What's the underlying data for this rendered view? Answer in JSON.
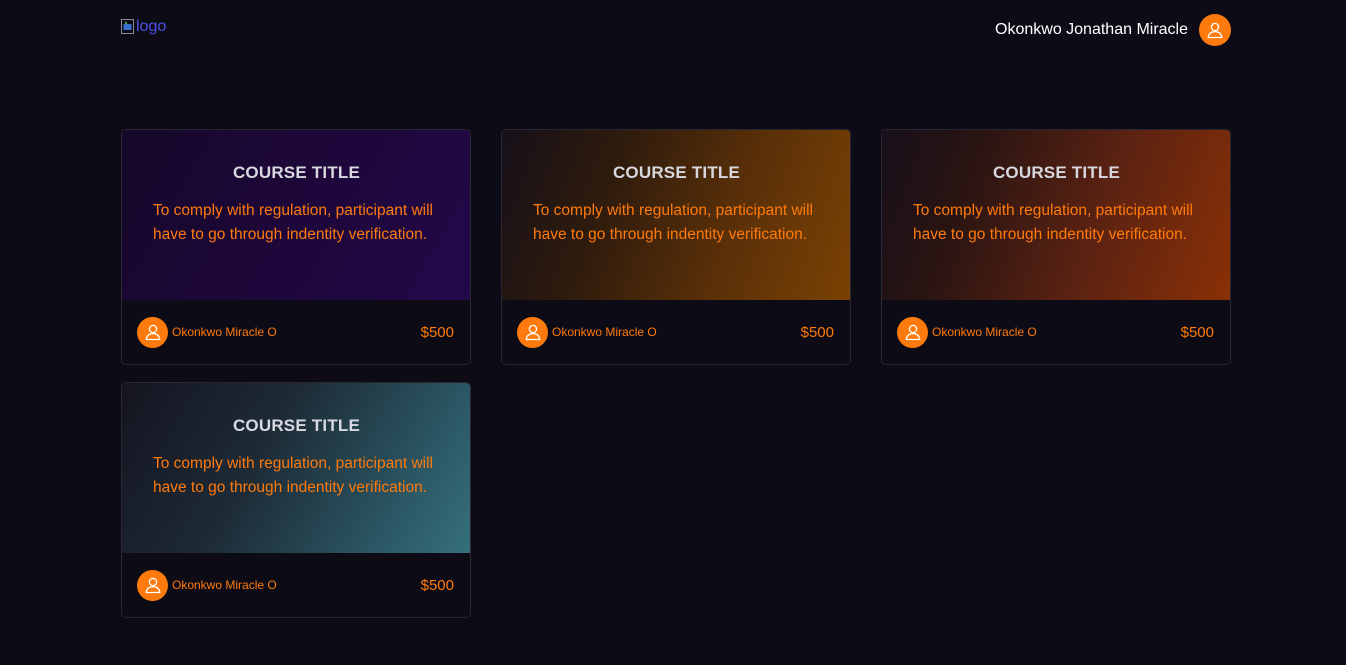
{
  "header": {
    "logo_alt": "logo",
    "user_name": "Okonkwo Jonathan Miracle",
    "avatar_icon": "user-icon"
  },
  "courses": [
    {
      "title": "COURSE TITLE",
      "description": "To comply with regulation, participant will have to go through indentity verification.",
      "author": "Okonkwo Miracle O",
      "price": "$500",
      "theme": "purple"
    },
    {
      "title": "COURSE TITLE",
      "description": "To comply with regulation, participant will have to go through indentity verification.",
      "author": "Okonkwo Miracle O",
      "price": "$500",
      "theme": "orange"
    },
    {
      "title": "COURSE TITLE",
      "description": "To comply with regulation, participant will have to go through indentity verification.",
      "author": "Okonkwo Miracle O",
      "price": "$500",
      "theme": "red"
    },
    {
      "title": "COURSE TITLE",
      "description": "To comply with regulation, participant will have to go through indentity verification.",
      "author": "Okonkwo Miracle O",
      "price": "$500",
      "theme": "teal"
    }
  ],
  "colors": {
    "background": "#0d0b16",
    "accent": "#ff7a0c",
    "title_text": "#d8d8e0",
    "logo_link": "#4a52e8"
  }
}
